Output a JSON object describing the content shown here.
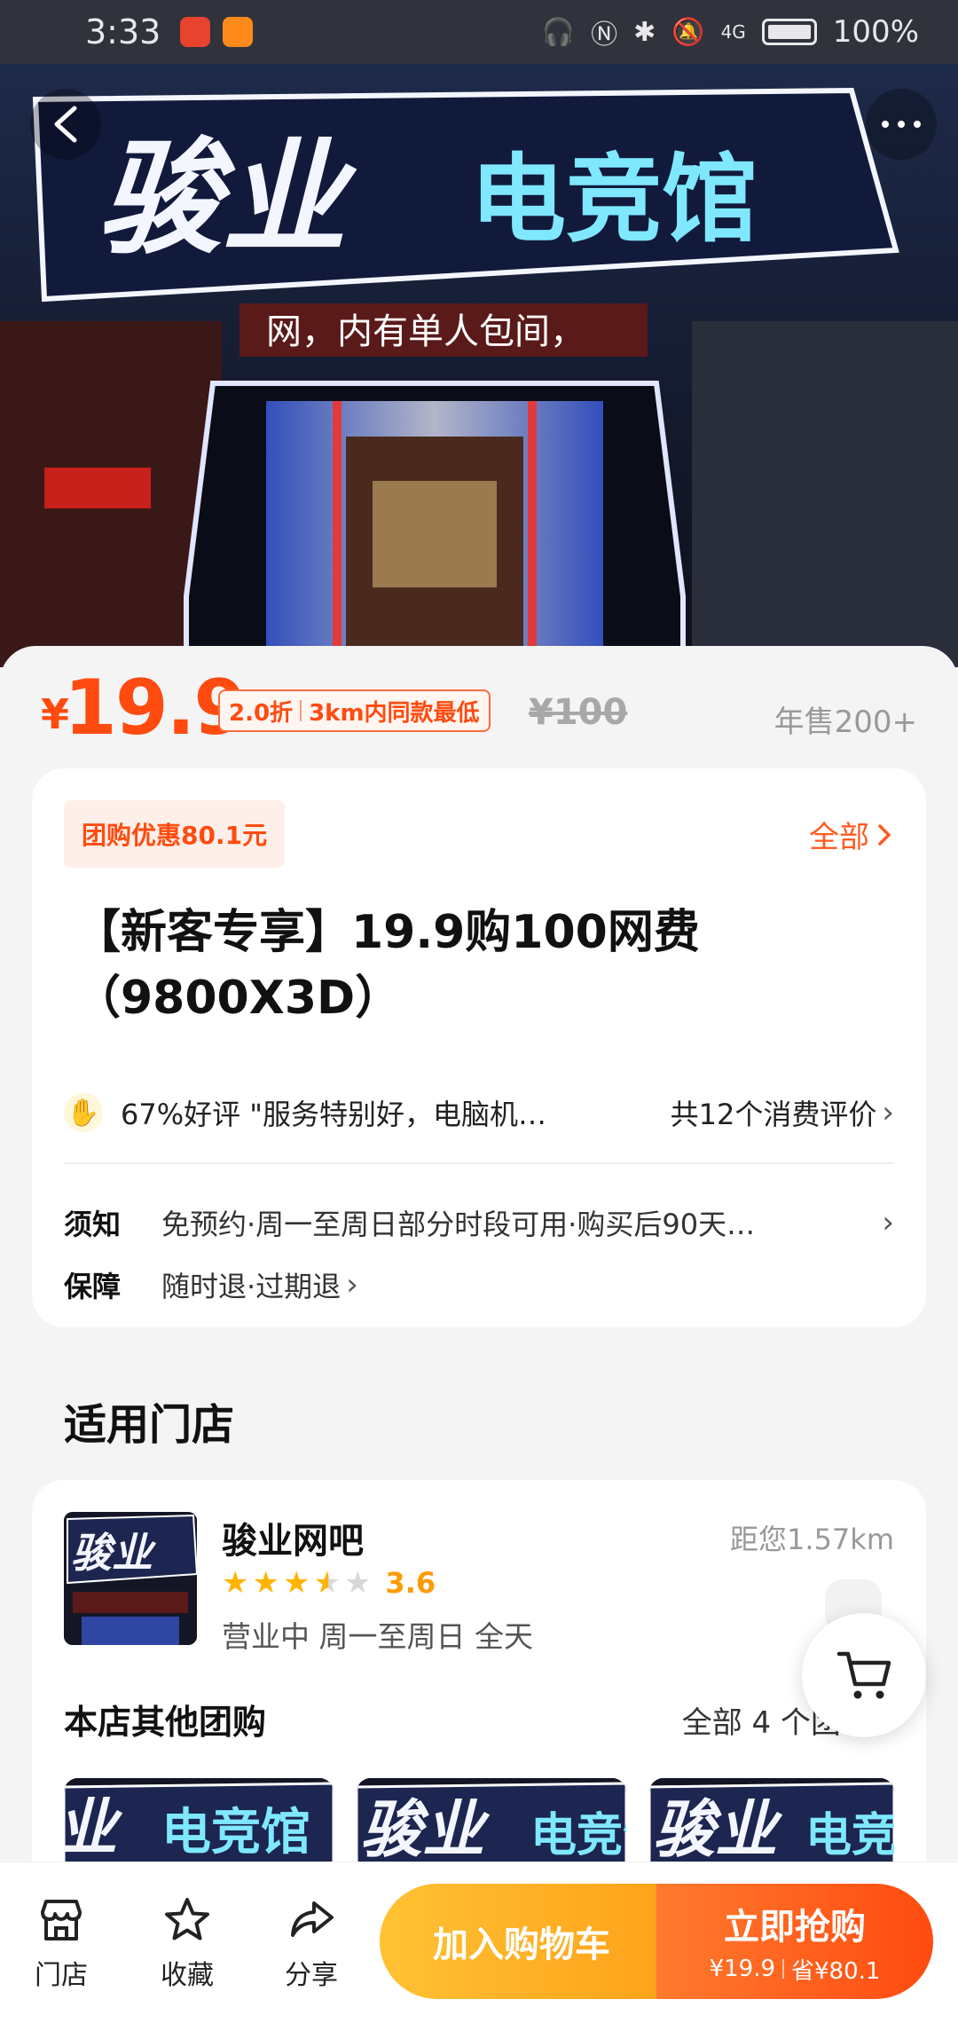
{
  "status": {
    "time": "3:33",
    "battery": "100%",
    "network": "4G"
  },
  "hero": {
    "sign_text_left": "骏业",
    "sign_text_right": "电竞馆",
    "banner_text": "网，内有单人包间，"
  },
  "price": {
    "currency": "¥",
    "value": "19.9",
    "discount": "2.0折",
    "lowest": "3km内同款最低",
    "original": "¥100",
    "sales": "年售200+"
  },
  "deal": {
    "promo_badge": "团购优惠80.1元",
    "all_label": "全部",
    "title_line1": "【新客专享】19.9购100网费",
    "title_line2": "（9800X3D）",
    "review_text": "67%好评 \"服务特别好，电脑机…",
    "review_count": "共12个消费评价",
    "notice_label": "须知",
    "notice_value": "免预约·周一至周日部分时段可用·购买后90天…",
    "guarantee_label": "保障",
    "guarantee_value": "随时退·过期退"
  },
  "stores": {
    "section_title": "适用门店",
    "store_name": "骏业网吧",
    "distance": "距您1.57km",
    "rating": 3.6,
    "rating_text": "3.6",
    "hours": "营业中  周一至周日 全天",
    "other_title": "本店其他团购",
    "other_all": "全部 4 个团"
  },
  "bottom": {
    "nav_store": "门店",
    "nav_fav": "收藏",
    "nav_share": "分享",
    "add_cart": "加入购物车",
    "buy_now": "立即抢购",
    "buy_price": "¥19.9",
    "buy_save": "省¥80.1"
  },
  "colors": {
    "accent": "#ff4b10",
    "cart_btn": "#ffb020",
    "star": "#ffb400"
  }
}
